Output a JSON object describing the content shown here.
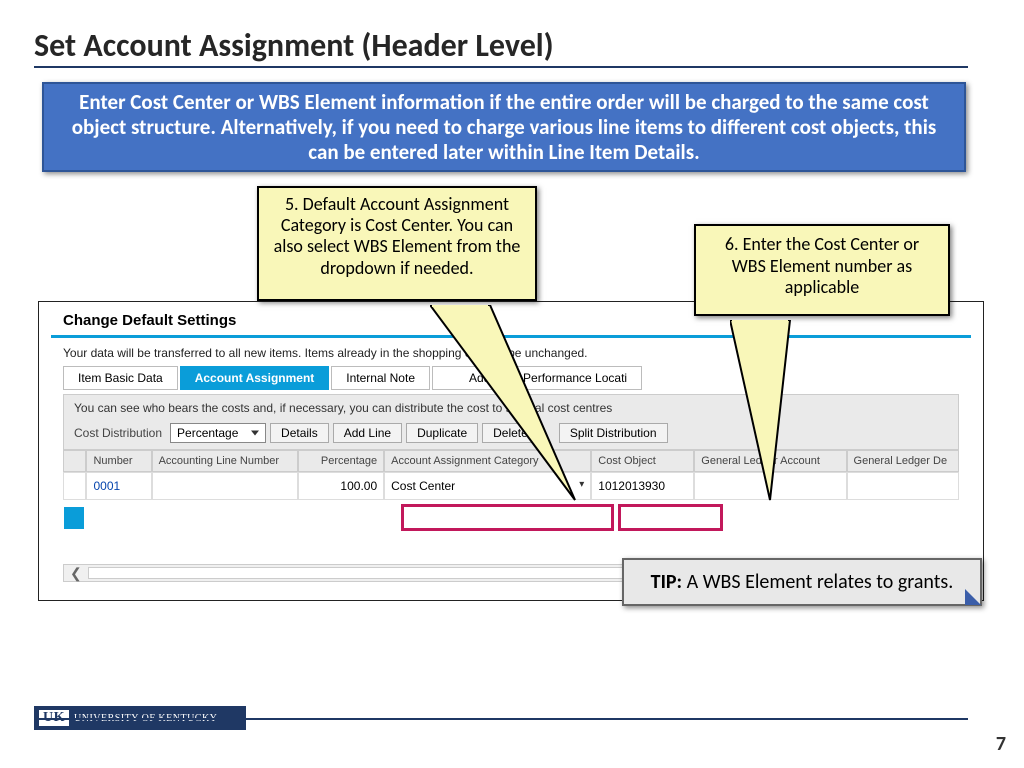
{
  "title": "Set Account Assignment (Header Level)",
  "blue_text": "Enter Cost Center or WBS Element information if the entire order will be charged to the same cost object structure. Alternatively, if you need to charge various line items to different cost objects, this can be entered later within Line Item Details.",
  "callout5": "5. Default Account Assignment Category is Cost Center. You can also select WBS Element from the dropdown if needed.",
  "callout6": "6. Enter the Cost Center or WBS Element number as applicable",
  "panel": {
    "header": "Change Default Settings",
    "sub": "Your data will be transferred to all new items. Items already in the shopping cart will be unchanged.",
    "tabs": {
      "basic": "Item Basic Data",
      "account": "Account Assignment",
      "internal": "Internal Note",
      "address": "Address / Performance Locati"
    },
    "desc": "You can see who bears the costs and, if necessary, you can distribute the cost to several cost centres",
    "toolbar": {
      "label": "Cost Distribution",
      "dropdown": "Percentage",
      "details": "Details",
      "addline": "Add Line",
      "duplicate": "Duplicate",
      "delete": "Delete",
      "split": "Split Distribution"
    },
    "cols": {
      "num": "Number",
      "acct": "Accounting Line Number",
      "pct": "Percentage",
      "aac": "Account Assignment Category",
      "cobj": "Cost Object",
      "gla": "General Ledger Account",
      "glde": "General Ledger De"
    },
    "row": {
      "num": "0001",
      "pct": "100.00",
      "aac": "Cost Center",
      "cobj": "1012013930"
    }
  },
  "tip": {
    "label": "TIP:",
    "text": " A WBS Element relates to grants."
  },
  "footer": {
    "uk": "UNIVERSITY OF KENTUCKY",
    "initials": "UK"
  },
  "page": "7"
}
